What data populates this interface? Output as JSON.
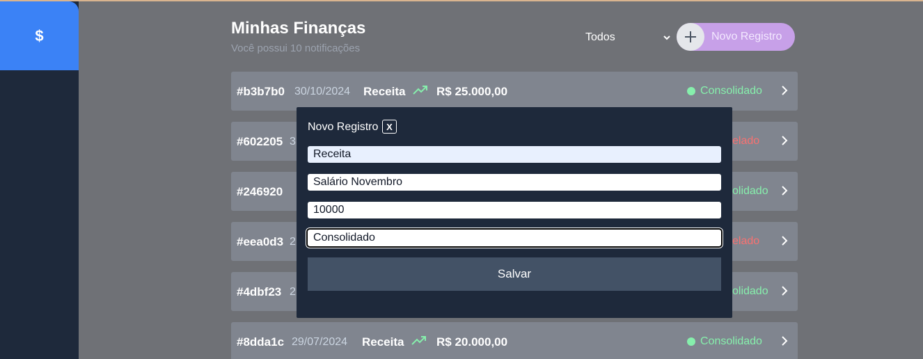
{
  "sidebar": {
    "items": [
      {
        "icon": "dollar-icon",
        "glyph": "$"
      }
    ]
  },
  "header": {
    "title": "Minhas Finanças",
    "subtitle": "Você possui 10 notificações",
    "filter_value": "Todos",
    "new_button_label": "Novo Registro"
  },
  "records": [
    {
      "id": "#b3b7b0",
      "date": "30/10/2024",
      "type": "Receita",
      "amount": "R$ 25.000,00",
      "status": "Consolidado"
    },
    {
      "id": "#602205",
      "date": "3",
      "status": "elado"
    },
    {
      "id": "#246920",
      "status": "olidado"
    },
    {
      "id": "#eea0d3",
      "date": "2",
      "status": "elado"
    },
    {
      "id": "#4dbf23",
      "date": "2",
      "status": "olidado"
    },
    {
      "id": "#8dda1c",
      "date": "29/07/2024",
      "type": "Receita",
      "amount": "R$ 20.000,00",
      "status": "Consolidado"
    }
  ],
  "modal": {
    "title": "Novo Registro",
    "close_label": "X",
    "fields": {
      "type": "Receita",
      "description": "Salário Novembro",
      "amount": "10000",
      "status": "Consolidado"
    },
    "save_label": "Salvar"
  },
  "colors": {
    "accent": "#3b82f6",
    "sidebar_bg": "#1e293b",
    "income_green": "#86efac",
    "cancel_red": "#f87171",
    "new_button": "#c7a0e8"
  }
}
